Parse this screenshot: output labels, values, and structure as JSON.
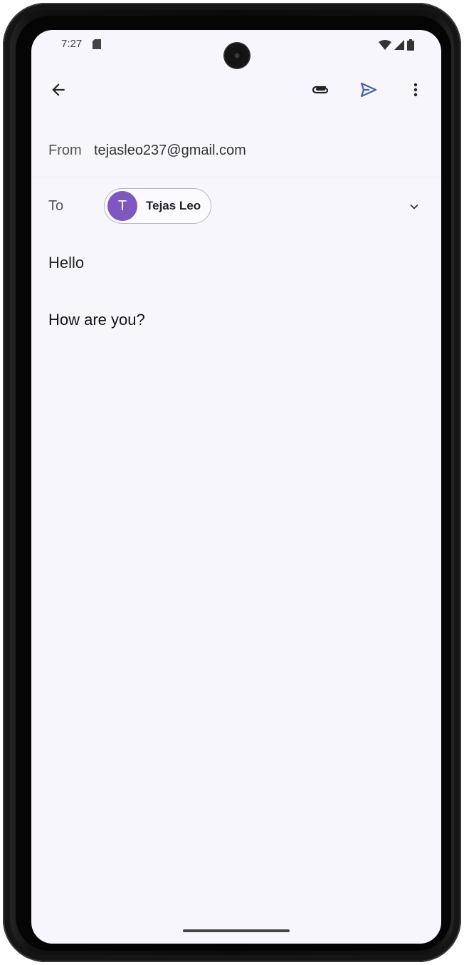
{
  "status_bar": {
    "time": "7:27"
  },
  "toolbar": {
    "back_icon": "arrow-back-icon",
    "attach_icon": "paperclip-icon",
    "send_icon": "send-icon",
    "more_icon": "more-vert-icon",
    "send_color": "#4a5fa8"
  },
  "compose": {
    "from_label": "From",
    "from_value": "tejasleo237@gmail.com",
    "to_label": "To",
    "recipient": {
      "initial": "T",
      "name": "Tejas Leo",
      "avatar_color": "#7e57c2"
    },
    "subject": "Hello",
    "body": "How are you?"
  }
}
